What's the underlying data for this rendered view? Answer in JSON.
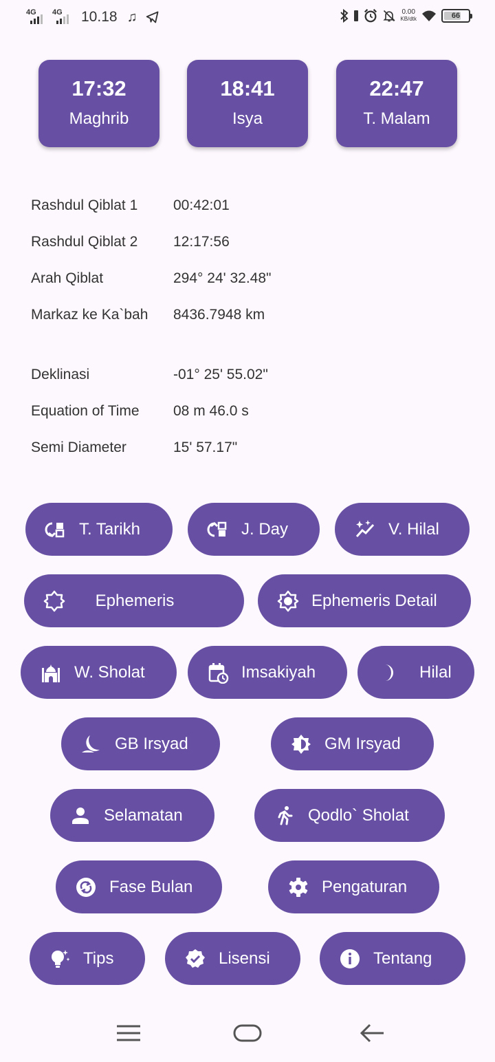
{
  "status_bar": {
    "network_1": "4G",
    "network_2": "4G",
    "time": "10.18",
    "speed_value": "0.00",
    "speed_unit": "KB/dtk",
    "battery": "66",
    "icons": [
      "music-note-icon",
      "telegram-icon",
      "bluetooth-icon",
      "vibrate-icon",
      "alarm-icon",
      "notifications-off-icon",
      "wifi-icon",
      "battery-icon"
    ]
  },
  "prayer_cards": [
    {
      "time": "17:32",
      "name": "Maghrib"
    },
    {
      "time": "18:41",
      "name": "Isya"
    },
    {
      "time": "22:47",
      "name": "T. Malam"
    }
  ],
  "qibla_info": [
    {
      "label": "Rashdul Qiblat 1",
      "value": "00:42:01"
    },
    {
      "label": "Rashdul Qiblat 2",
      "value": "12:17:56"
    },
    {
      "label": "Arah Qiblat",
      "value": "294° 24' 32.48\""
    },
    {
      "label": "Markaz ke Ka`bah",
      "value": "8436.7948 km"
    }
  ],
  "sun_info": [
    {
      "label": "Deklinasi",
      "value": "-01° 25' 55.02\""
    },
    {
      "label": "Equation of Time",
      "value": "08 m 46.0 s"
    },
    {
      "label": "Semi Diameter",
      "value": "15' 57.17\""
    }
  ],
  "buttons": {
    "t_tarikh": {
      "label": "T. Tarikh",
      "icon": "convert-icon"
    },
    "j_day": {
      "label": "J. Day",
      "icon": "convert-icon"
    },
    "v_hilal": {
      "label": "V. Hilal",
      "icon": "sparkle-chart-icon"
    },
    "ephemeris": {
      "label": "Ephemeris",
      "icon": "sun-outline-icon"
    },
    "ephemeris_detail": {
      "label": "Ephemeris Detail",
      "icon": "brightness-icon"
    },
    "w_sholat": {
      "label": "W. Sholat",
      "icon": "mosque-icon"
    },
    "imsakiyah": {
      "label": "Imsakiyah",
      "icon": "calendar-clock-icon"
    },
    "hilal": {
      "label": "Hilal",
      "icon": "crescent-moon-icon"
    },
    "gb_irsyad": {
      "label": "GB Irsyad",
      "icon": "night-icon"
    },
    "gm_irsyad": {
      "label": "GM Irsyad",
      "icon": "brightness-half-icon"
    },
    "selamatan": {
      "label": "Selamatan",
      "icon": "person-icon"
    },
    "qodlo_sholat": {
      "label": "Qodlo` Sholat",
      "icon": "running-icon"
    },
    "fase_bulan": {
      "label": "Fase Bulan",
      "icon": "sync-icon"
    },
    "pengaturan": {
      "label": "Pengaturan",
      "icon": "gear-icon"
    },
    "tips": {
      "label": "Tips",
      "icon": "lightbulb-icon"
    },
    "lisensi": {
      "label": "Lisensi",
      "icon": "verified-icon"
    },
    "tentang": {
      "label": "Tentang",
      "icon": "info-icon"
    }
  },
  "colors": {
    "primary": "#6750a4",
    "background": "#fdf8fd"
  }
}
